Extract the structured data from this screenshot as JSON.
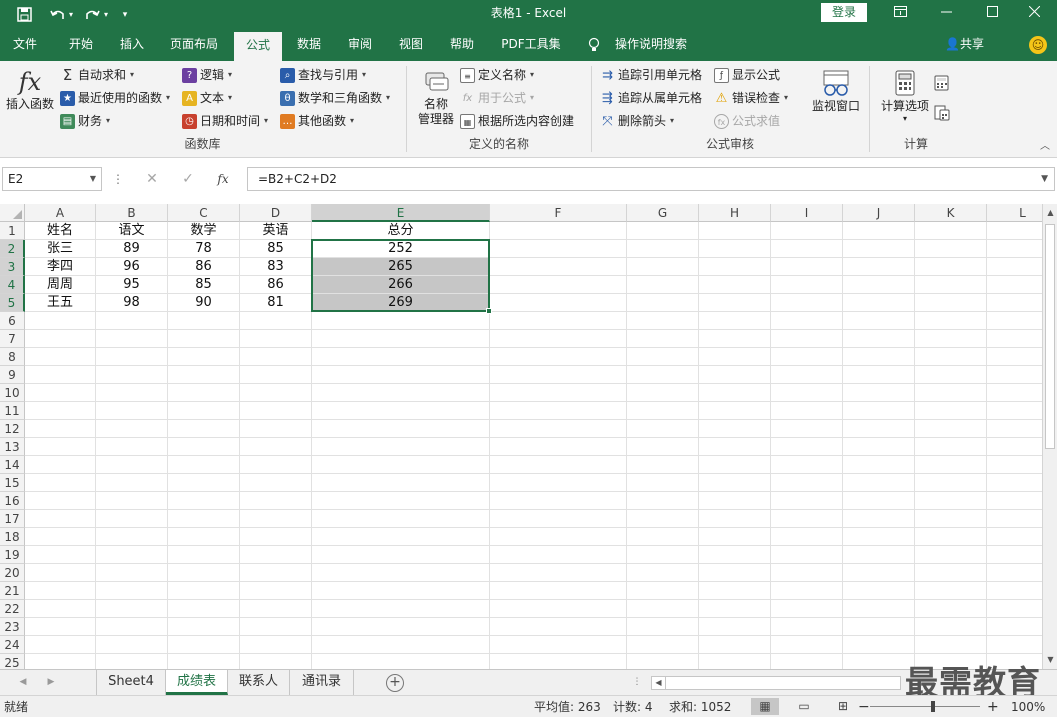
{
  "window": {
    "title": "表格1  -  Excel",
    "login_label": "登录",
    "ribbon_display_icon": "ribbon-display-icon",
    "minimize_icon": "minimize-icon",
    "maximize_icon": "maximize-icon",
    "close_icon": "close-icon"
  },
  "quick_access": {
    "save_icon": "save-icon",
    "undo_icon": "undo-icon",
    "redo_icon": "redo-icon",
    "customize_icon": "customize-icon"
  },
  "tabs": [
    {
      "label": "文件"
    },
    {
      "label": "开始"
    },
    {
      "label": "插入"
    },
    {
      "label": "页面布局"
    },
    {
      "label": "公式"
    },
    {
      "label": "数据"
    },
    {
      "label": "审阅"
    },
    {
      "label": "视图"
    },
    {
      "label": "帮助"
    },
    {
      "label": "PDF工具集"
    },
    {
      "label": "操作说明搜索"
    }
  ],
  "active_tab": "公式",
  "share_label": "共享",
  "ribbon": {
    "function_library": {
      "group_label": "函数库",
      "insert_function": "插入函数",
      "autosum": "自动求和",
      "recently_used": "最近使用的函数",
      "financial": "财务",
      "logical": "逻辑",
      "text": "文本",
      "date_time": "日期和时间",
      "lookup": "查找与引用",
      "math_trig": "数学和三角函数",
      "more_functions": "其他函数"
    },
    "defined_names": {
      "group_label": "定义的名称",
      "name_manager_line1": "名称",
      "name_manager_line2": "管理器",
      "define_name": "定义名称",
      "use_in_formula": "用于公式",
      "create_from_selection": "根据所选内容创建"
    },
    "formula_auditing": {
      "group_label": "公式审核",
      "trace_precedents": "追踪引用单元格",
      "trace_dependents": "追踪从属单元格",
      "remove_arrows": "删除箭头",
      "show_formulas": "显示公式",
      "error_checking": "错误检查",
      "evaluate_formula": "公式求值",
      "watch_window": "监视窗口"
    },
    "calculation": {
      "group_label": "计算",
      "calc_options": "计算选项"
    }
  },
  "formula_bar": {
    "name_box": "E2",
    "formula": "=B2+C2+D2"
  },
  "columns": [
    "A",
    "B",
    "C",
    "D",
    "E",
    "F",
    "G",
    "H",
    "I",
    "J",
    "K",
    "L"
  ],
  "row_numbers": [
    "1",
    "2",
    "3",
    "4",
    "5",
    "6",
    "7",
    "8",
    "9",
    "10",
    "11",
    "12",
    "13",
    "14",
    "15",
    "16",
    "17",
    "18",
    "19",
    "20",
    "21",
    "22",
    "23",
    "24",
    "25"
  ],
  "table": {
    "header": [
      "姓名",
      "语文",
      "数学",
      "英语",
      "总分"
    ],
    "rows": [
      [
        "张三",
        "89",
        "78",
        "85",
        "252"
      ],
      [
        "李四",
        "96",
        "86",
        "83",
        "265"
      ],
      [
        "周周",
        "95",
        "85",
        "86",
        "266"
      ],
      [
        "王五",
        "98",
        "90",
        "81",
        "269"
      ]
    ]
  },
  "sheets": [
    {
      "label": "Sheet4"
    },
    {
      "label": "成绩表"
    },
    {
      "label": "联系人"
    },
    {
      "label": "通讯录"
    }
  ],
  "active_sheet": "成绩表",
  "status": {
    "ready": "就绪",
    "average": "平均值: 263",
    "count": "计数: 4",
    "sum": "求和: 1052",
    "zoom": "100%"
  },
  "watermark": "最需教育",
  "colors": {
    "accent": "#217346",
    "selection_fill": "#c6c6c6"
  }
}
